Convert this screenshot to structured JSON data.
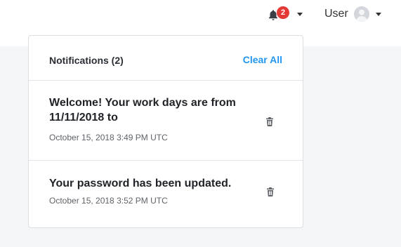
{
  "nav": {
    "notifications": {
      "count": "2",
      "icon": "bell-icon",
      "badge_color": "#e53935"
    },
    "user": {
      "label": "User",
      "avatar_icon": "user-avatar-icon"
    }
  },
  "dropdown": {
    "title": "Notifications (2)",
    "clear_all_label": "Clear All",
    "accent_color": "#2196f3",
    "items": [
      {
        "message": "Welcome! Your work days are from 11/11/2018 to",
        "timestamp": "October 15, 2018 3:49 PM UTC",
        "delete_icon": "trash-icon"
      },
      {
        "message": "Your password has been updated.",
        "timestamp": "October 15, 2018 3:52 PM UTC",
        "delete_icon": "trash-icon"
      }
    ]
  }
}
